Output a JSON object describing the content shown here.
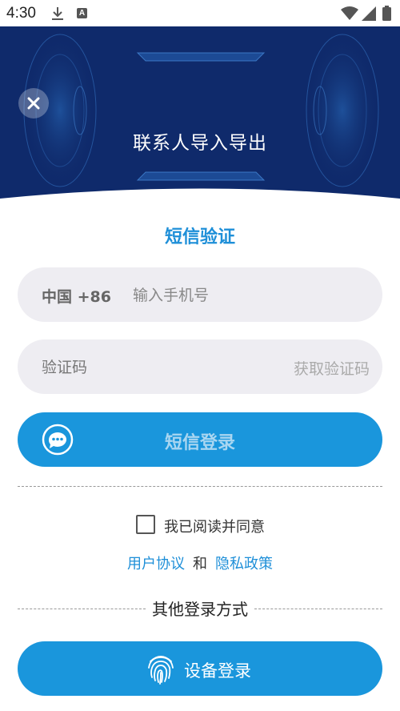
{
  "status_bar": {
    "time": "4:30",
    "icons": [
      "download-icon",
      "a-badge-icon",
      "wifi-icon",
      "signal-icon",
      "battery-icon"
    ]
  },
  "header": {
    "title": "联系人导入导出",
    "close_icon": "close-icon",
    "bg_color": "#0f2a6b"
  },
  "form": {
    "title": "短信验证",
    "country_code": "中国 +86",
    "phone_placeholder": "输入手机号",
    "code_placeholder": "验证码",
    "get_code_label": "获取验证码",
    "sms_login_label": "短信登录"
  },
  "agreement": {
    "checkbox_label": "我已阅读并同意",
    "checked": false,
    "user_agreement": "用户协议",
    "and": "和",
    "privacy_policy": "隐私政策"
  },
  "other_login": {
    "title": "其他登录方式",
    "device_login_label": "设备登录"
  },
  "colors": {
    "accent": "#1a96dc",
    "field_bg": "#eeedf2",
    "link": "#1e8fd8"
  }
}
